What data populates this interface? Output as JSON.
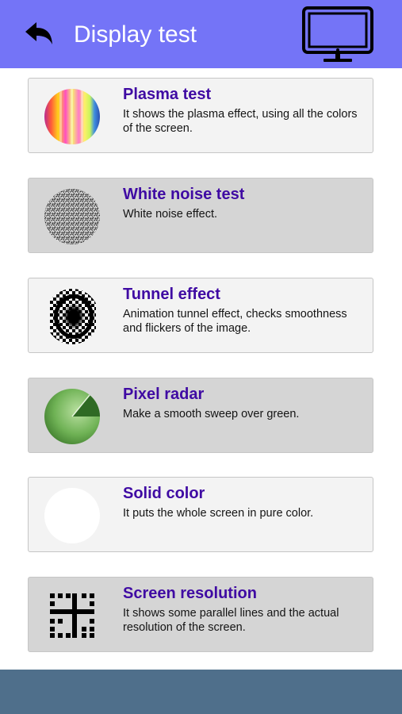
{
  "header": {
    "title": "Display test",
    "back_icon": "back-arrow-icon",
    "monitor_icon": "monitor-icon",
    "background": "#7474f7"
  },
  "tests": [
    {
      "title": "Plasma test",
      "description": "It shows the plasma effect, using all the colors of the screen.",
      "icon": "plasma-icon"
    },
    {
      "title": "White noise test",
      "description": "White noise effect.",
      "icon": "white-noise-icon"
    },
    {
      "title": "Tunnel effect",
      "description": "Animation tunnel effect, checks smoothness and flickers of the image.",
      "icon": "tunnel-icon"
    },
    {
      "title": "Pixel radar",
      "description": "Make a smooth sweep over green.",
      "icon": "radar-icon"
    },
    {
      "title": "Solid color",
      "description": "It puts the whole screen in pure color.",
      "icon": "solid-color-icon"
    },
    {
      "title": "Screen resolution",
      "description": "It shows some parallel lines and the actual resolution of the screen.",
      "icon": "resolution-grid-icon"
    }
  ],
  "colors": {
    "title_text": "#3f0aa3",
    "card_light": "#f3f3f3",
    "card_dark": "#d5d5d5",
    "footer": "#4f6f8b"
  }
}
